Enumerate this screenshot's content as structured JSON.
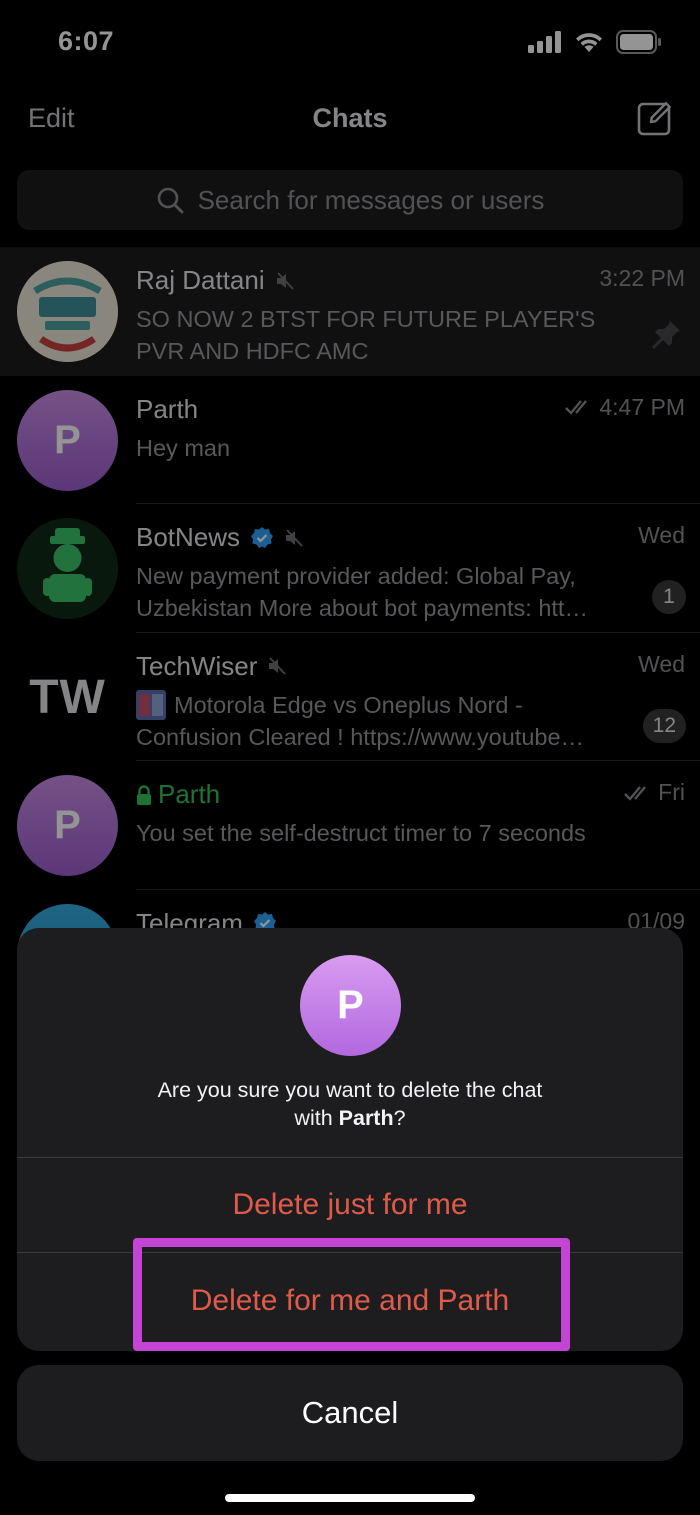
{
  "status": {
    "time": "6:07"
  },
  "nav": {
    "edit_label": "Edit",
    "title": "Chats"
  },
  "search": {
    "placeholder": "Search for messages or users"
  },
  "chats": [
    {
      "name": "Raj Dattani",
      "time": "3:22 PM",
      "line1": "SO NOW 2 BTST FOR FUTURE PLAYER'S",
      "line2": "PVR AND HDFC AMC"
    },
    {
      "name": "Parth",
      "initial": "P",
      "time": "4:47 PM",
      "line1": "Hey man"
    },
    {
      "name": "BotNews",
      "time": "Wed",
      "line1": "New payment provider added: Global Pay,",
      "line2": "Uzbekistan  More about bot payments: htt…",
      "badge": "1"
    },
    {
      "name": "TechWiser",
      "logo": "TW",
      "time": "Wed",
      "line1": "Motorola Edge vs Oneplus Nord -",
      "line2": "Confusion Cleared ! https://www.youtube…",
      "badge": "12"
    },
    {
      "name": "Parth",
      "initial": "P",
      "time": "Fri",
      "line1": "You set the self-destruct timer to 7 seconds"
    },
    {
      "name": "Telegram",
      "time": "01/09"
    }
  ],
  "sheet": {
    "initial": "P",
    "message_prefix": "Are you sure you want to delete the chat",
    "message_with": "with",
    "message_name": "Parth",
    "message_suffix": "?",
    "delete_me_label": "Delete just for me",
    "delete_both_label": "Delete for me and Parth",
    "cancel_label": "Cancel"
  },
  "colors": {
    "destructive": "#e05a4a",
    "highlight": "#c444d6",
    "secret_chat": "#34c759",
    "verified": "#2ea6ff"
  }
}
